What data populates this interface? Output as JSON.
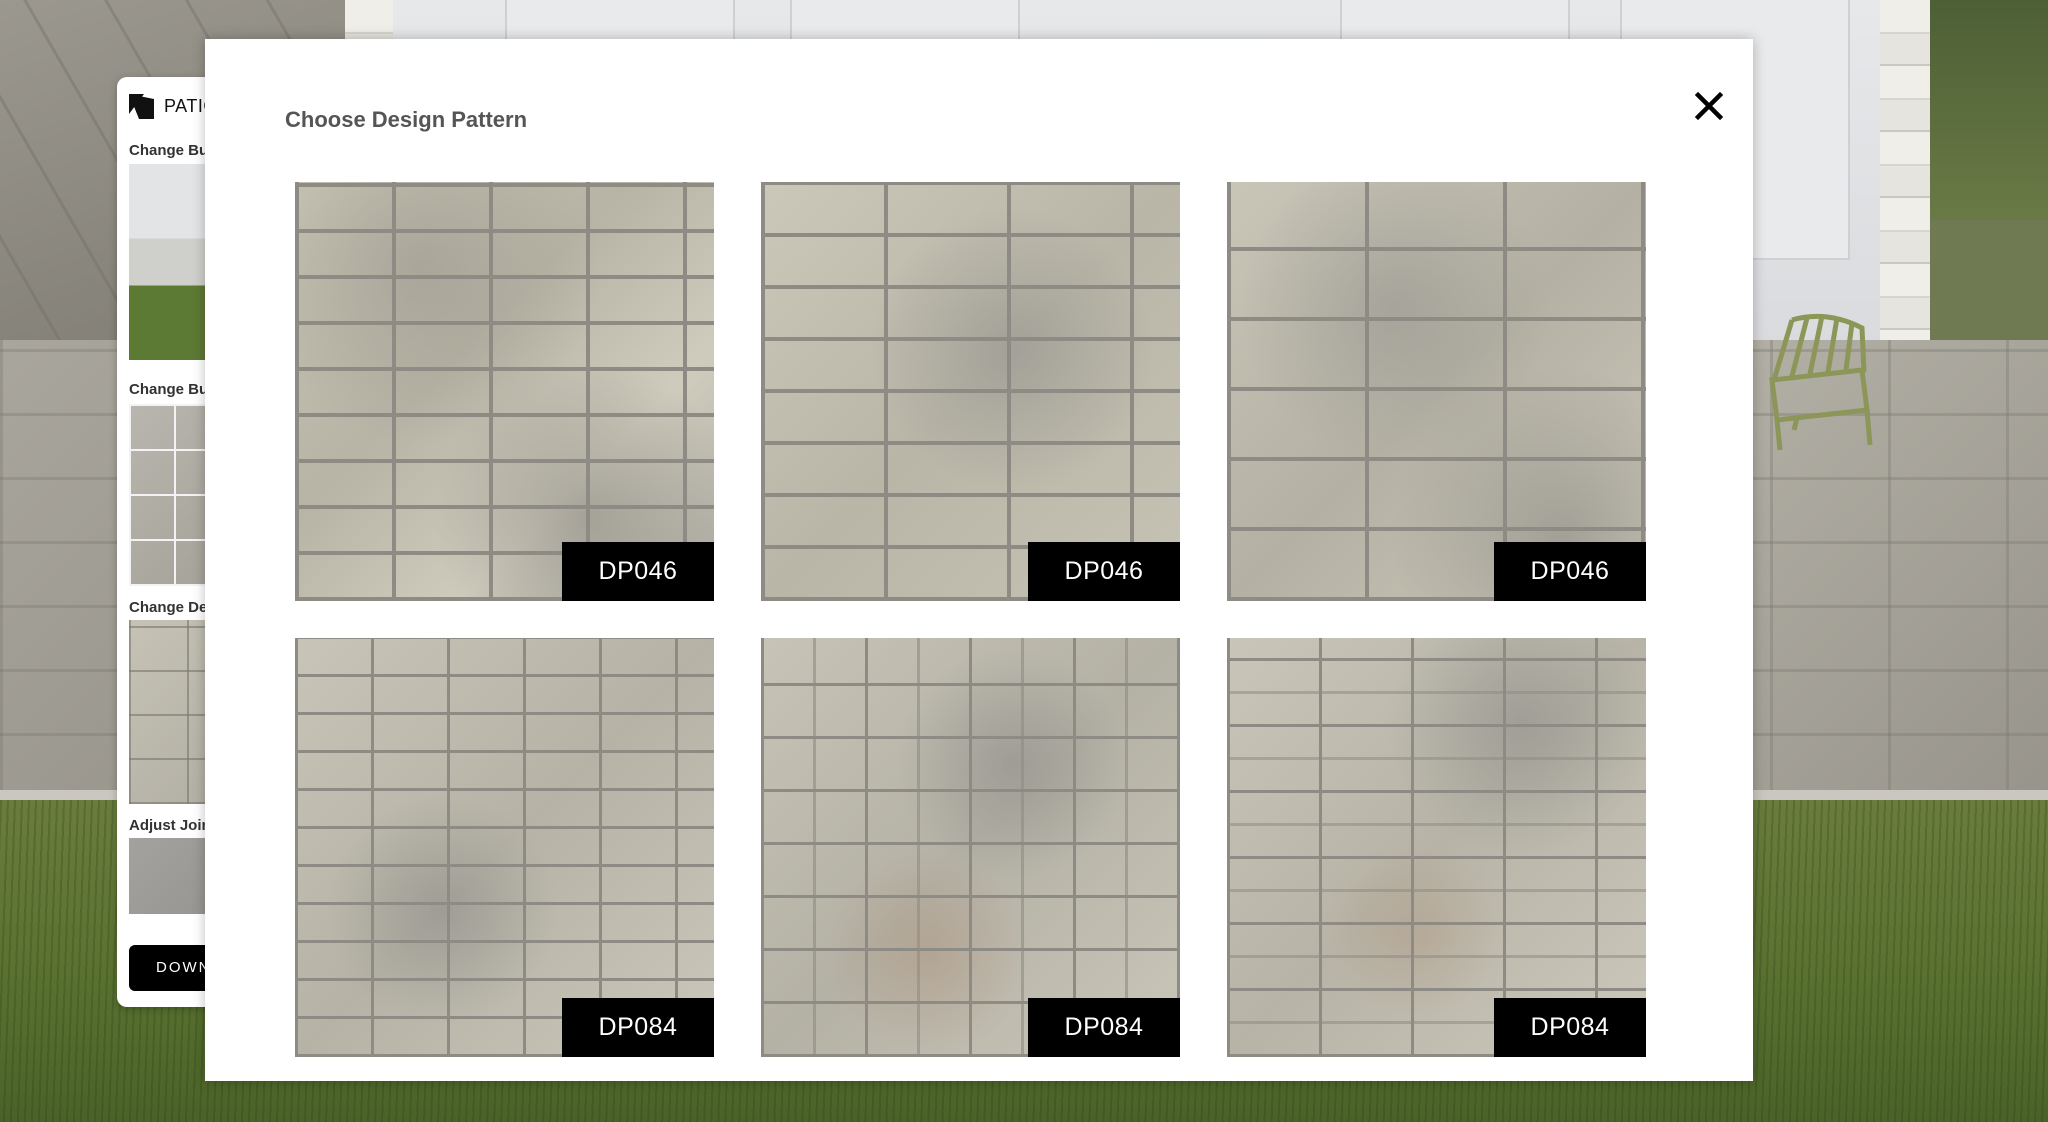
{
  "side_panel": {
    "brand_name": "PATIO",
    "sections": [
      {
        "label": "Change Building"
      },
      {
        "label": "Change Buildings"
      },
      {
        "label": "Change Design"
      },
      {
        "label": "Adjust Joint"
      }
    ],
    "download_label": "DOWNLOAD"
  },
  "modal": {
    "title": "Choose Design Pattern",
    "close_icon": "close-icon",
    "patterns": [
      {
        "code": "DP046",
        "style": "ashlar"
      },
      {
        "code": "DP046",
        "style": "ashlar"
      },
      {
        "code": "DP046",
        "style": "ashlar"
      },
      {
        "code": "DP084",
        "style": "random"
      },
      {
        "code": "DP084",
        "style": "random"
      },
      {
        "code": "DP084",
        "style": "random"
      }
    ]
  },
  "colors": {
    "modal_background": "#ffffff",
    "title_text": "#555555",
    "code_tag_background": "#000000",
    "code_tag_text": "#ffffff"
  }
}
